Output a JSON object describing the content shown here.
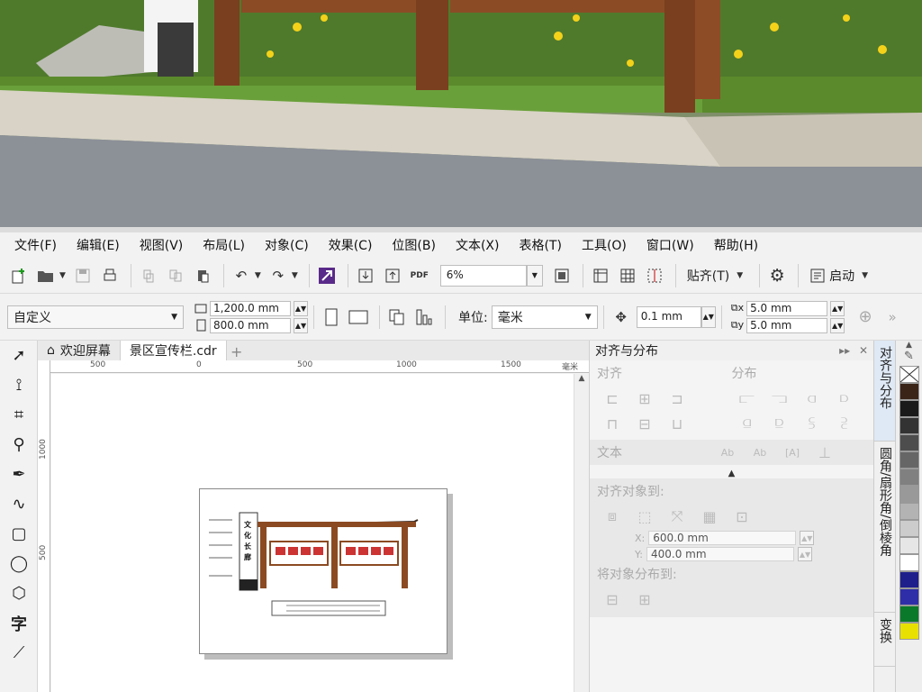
{
  "menu": [
    "文件(F)",
    "编辑(E)",
    "视图(V)",
    "布局(L)",
    "对象(C)",
    "效果(C)",
    "位图(B)",
    "文本(X)",
    "表格(T)",
    "工具(O)",
    "窗口(W)",
    "帮助(H)"
  ],
  "toolbar": {
    "pdf_label": "PDF",
    "zoom_value": "6%",
    "snap_label": "贴齐(T)",
    "launch_label": "启动"
  },
  "properties": {
    "preset": "自定义",
    "width": "1,200.0 mm",
    "height": "800.0 mm",
    "unit_label": "单位:",
    "unit_value": "毫米",
    "nudge": "0.1 mm",
    "dup_x": "5.0 mm",
    "dup_y": "5.0 mm"
  },
  "tabs": {
    "welcome": "欢迎屏幕",
    "document": "景区宣传栏.cdr"
  },
  "ruler": {
    "h_labels": [
      "500",
      "0",
      "500",
      "1000",
      "1500"
    ],
    "h_unit": "毫米",
    "v_labels": [
      "1000",
      "500"
    ]
  },
  "drawing": {
    "vertical_sign": "文化长廊"
  },
  "docker": {
    "title": "对齐与分布",
    "section_align": "对齐",
    "section_distribute": "分布",
    "section_text": "文本",
    "section_align_to": "对齐对象到:",
    "x_label": "X:",
    "x_value": "600.0 mm",
    "y_label": "Y:",
    "y_value": "400.0 mm",
    "section_distribute_to": "将对象分布到:"
  },
  "docker_tabs": [
    "对齐与分布",
    "圆角/扇形角/倒棱角",
    "变换"
  ],
  "palette": [
    "#ffffff",
    "#3a2418",
    "#1a1a1a",
    "#333333",
    "#4d4d4d",
    "#666666",
    "#808080",
    "#999999",
    "#b3b3b3",
    "#cccccc",
    "#e6e6e6",
    "#ffffff",
    "#1f1f8c",
    "#2e2ea8",
    "#0a7a2a",
    "#e8e000"
  ]
}
